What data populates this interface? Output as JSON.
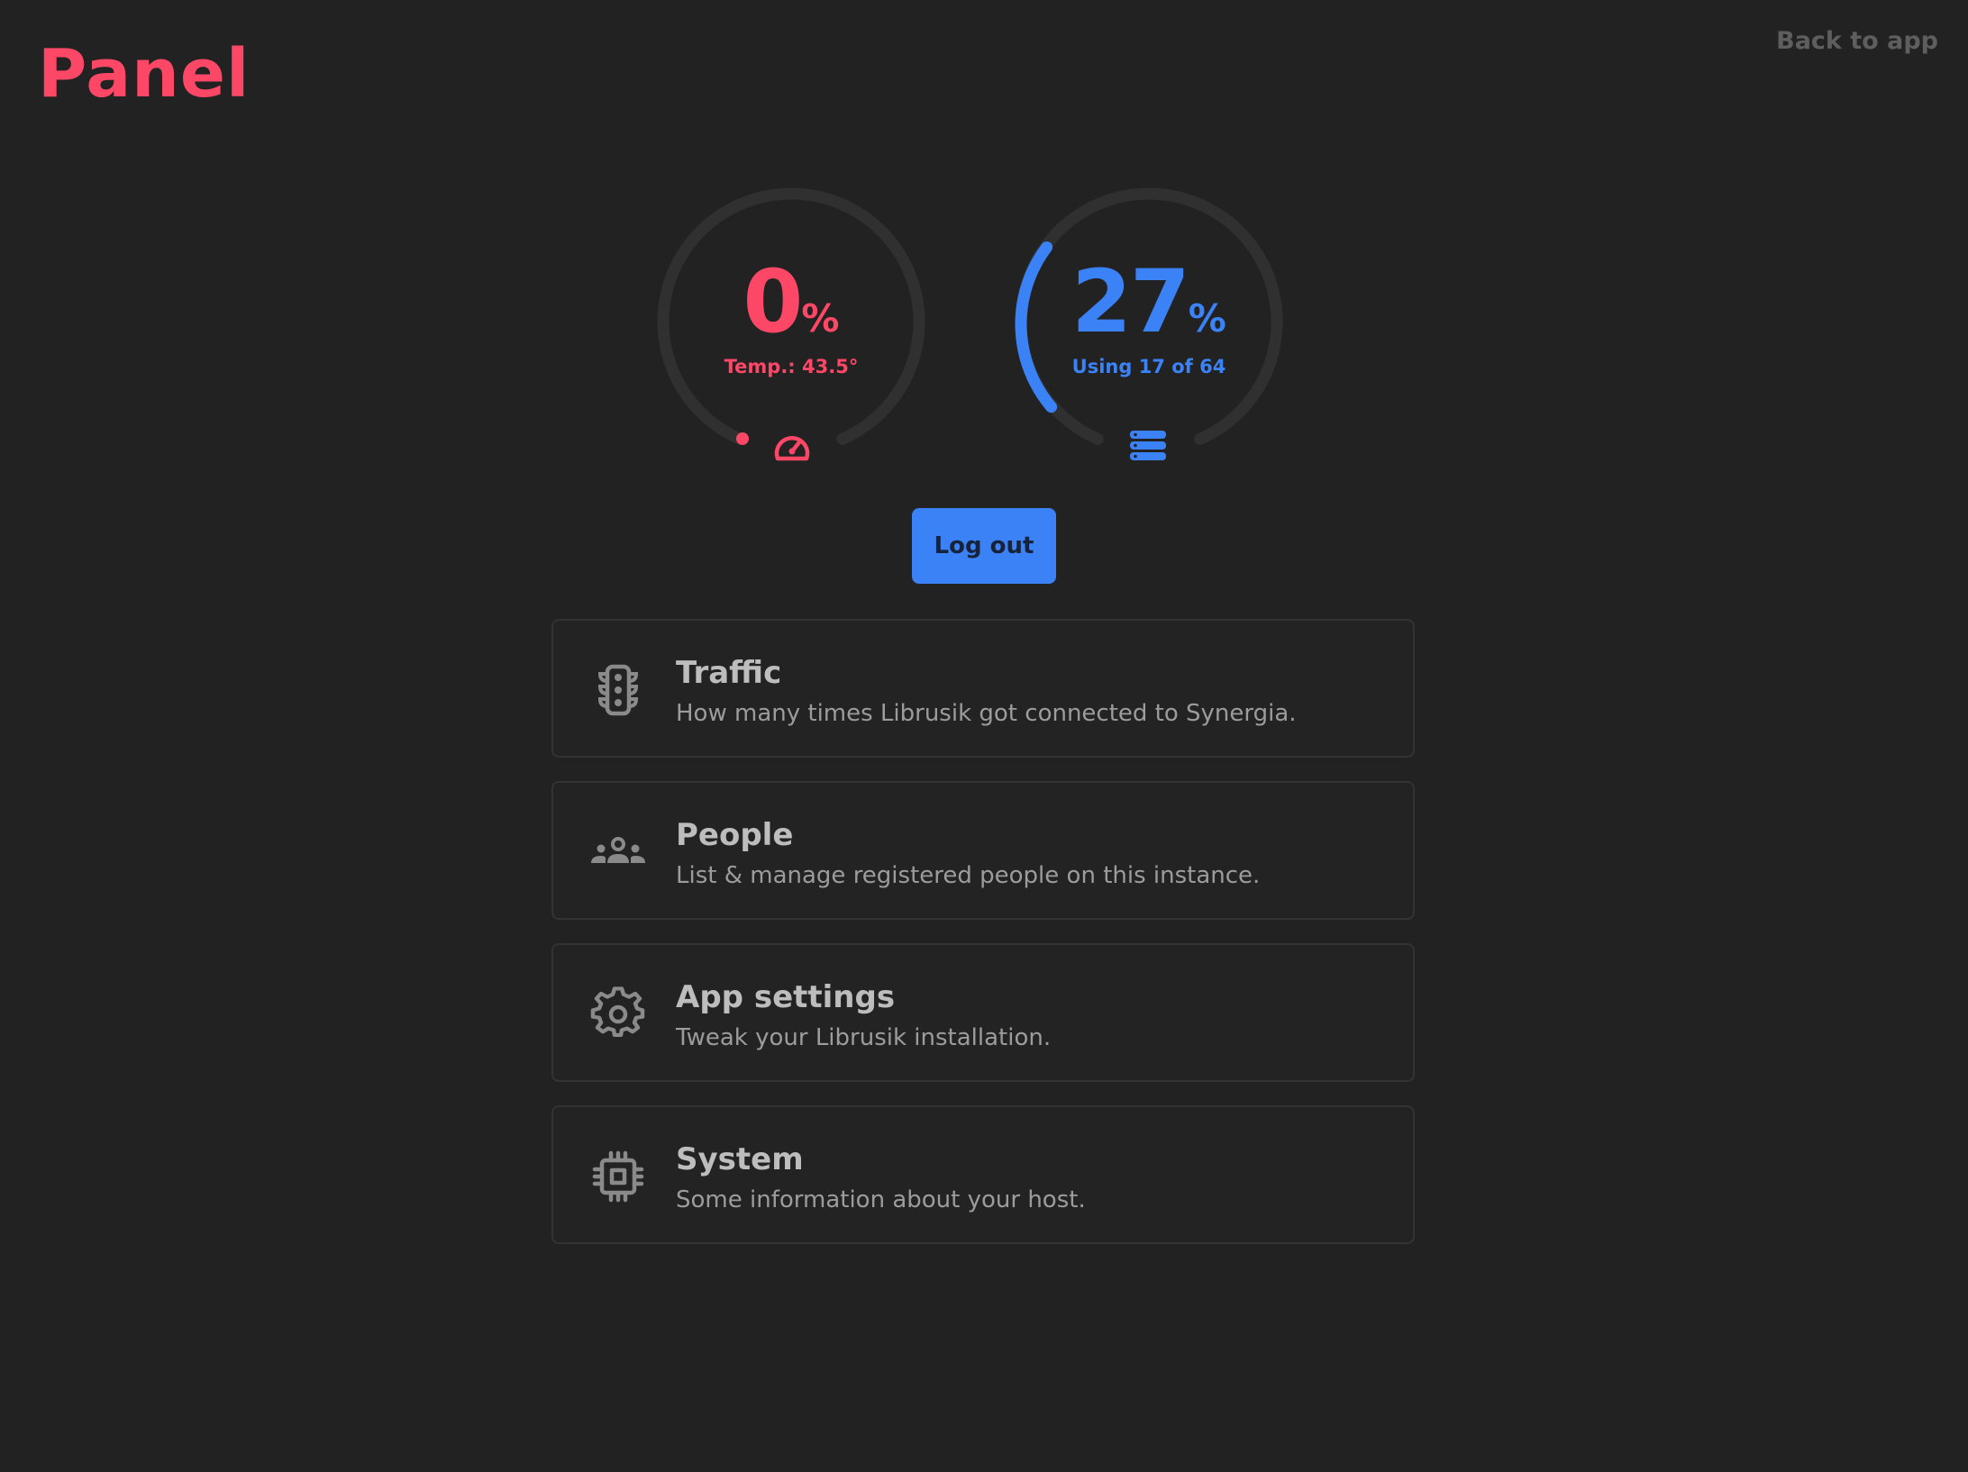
{
  "header": {
    "logo": "Panel",
    "back_link": "Back to app"
  },
  "gauges": {
    "cpu": {
      "value": "0",
      "percent_sign": "%",
      "fraction": 0.0,
      "subtitle": "Temp.: 43.5°",
      "icon": "speedometer-icon",
      "color": "#fc4766"
    },
    "memory": {
      "value": "27",
      "percent_sign": "%",
      "fraction": 0.27,
      "subtitle": "Using 17 of 64",
      "icon": "database-icon",
      "color": "#3b82f6"
    }
  },
  "actions": {
    "logout_label": "Log out"
  },
  "cards": [
    {
      "title": "Traffic",
      "description": "How many times Librusik got connected to Synergia.",
      "icon": "traffic-light-icon"
    },
    {
      "title": "People",
      "description": "List & manage registered people on this instance.",
      "icon": "users-icon"
    },
    {
      "title": "App settings",
      "description": "Tweak your Librusik installation.",
      "icon": "gear-icon"
    },
    {
      "title": "System",
      "description": "Some information about your host.",
      "icon": "cpu-chip-icon"
    }
  ],
  "theme": {
    "background": "#222222",
    "accent_red": "#fc4766",
    "accent_blue": "#3b82f6",
    "track": "#303030"
  }
}
